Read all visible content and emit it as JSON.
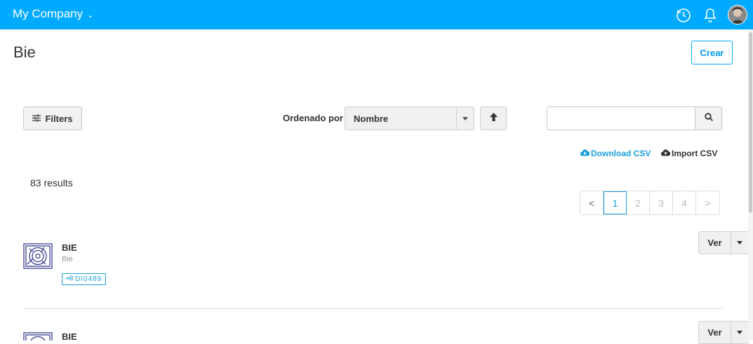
{
  "header": {
    "company": "My Company",
    "colors": {
      "bar": "#00aaff",
      "accent": "#1a9fdd"
    },
    "icons": [
      "history-icon",
      "bell-icon",
      "avatar"
    ]
  },
  "page": {
    "title": "Bie",
    "create_label": "Crear"
  },
  "toolbar": {
    "filters_label": "Filters",
    "sort_label": "Ordenado por",
    "sort_value": "Nombre",
    "search_value": "",
    "search_placeholder": ""
  },
  "csv": {
    "download_label": "Download CSV",
    "import_label": "Import CSV"
  },
  "results": {
    "count_text": "83 results"
  },
  "pagination": {
    "prev": "<",
    "next": ">",
    "pages": [
      "1",
      "2",
      "3",
      "4"
    ],
    "active": "1"
  },
  "items": [
    {
      "title": "BIE",
      "subtitle": "Bie",
      "tag": "DI0489",
      "action": "Ver"
    },
    {
      "title": "BIE",
      "action": "Ver"
    }
  ]
}
